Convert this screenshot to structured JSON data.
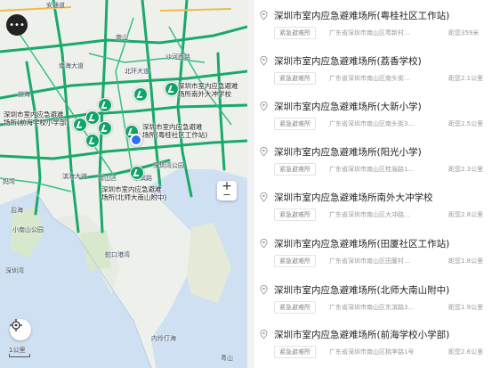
{
  "map": {
    "labels": {
      "a": "安通道",
      "b": "南山",
      "c": "西丽",
      "d": "南海大道",
      "e": "沙河西路",
      "f": "北环大道",
      "g": "滨海大道",
      "h": "南山区",
      "i": "前海",
      "j": "东滨路",
      "k": "妈湾",
      "l": "后海",
      "m": "小南山公园",
      "n": "深圳湾",
      "o": "蛇口港湾",
      "p": "内伶仃海",
      "q": "粤山",
      "r": "深圳湾公园"
    },
    "shelters": {
      "s1": "深圳市室内应急避难\n场所南外大冲学校",
      "s2": "深圳市室内应急避难\n场所(前海学校小学部)",
      "s3": "深圳市室内应急避难\n场所(粤桂社区工作站)",
      "s4": "深圳市室内应急避难\n场所(北师大南山附中)"
    },
    "more_button": "•••",
    "zoom_in": "+",
    "zoom_out": "−",
    "scale": "1公里"
  },
  "list": [
    {
      "title": "深圳市室内应急避难场所(粤桂社区工作站)",
      "tag": "紧急避难所",
      "addr": "广东省深圳市南山区粤新村...",
      "dist": "距您359米"
    },
    {
      "title": "深圳市室内应急避难场所(荔香学校)",
      "tag": "紧急避难所",
      "addr": "广东省深圳市南山区南头街...",
      "dist": "距您2.1公里"
    },
    {
      "title": "深圳市室内应急避难场所(大新小学)",
      "tag": "紧急避难所",
      "addr": "广东省深圳市南山区南头街3...",
      "dist": "距您2.5公里"
    },
    {
      "title": "深圳市室内应急避难场所(阳光小学)",
      "tag": "紧急避难所",
      "addr": "广东省深圳市南山区桂庙路1...",
      "dist": "距您2.3公里"
    },
    {
      "title": "深圳市室内应急避难场所南外大冲学校",
      "tag": "紧急避难所",
      "addr": "广东省深圳市南山区大冲路...",
      "dist": "距您2.8公里"
    },
    {
      "title": "深圳市室内应急避难场所(田厦社区工作站)",
      "tag": "紧急避难所",
      "addr": "广东省深圳市南山区田厦村...",
      "dist": "距您1.8公里"
    },
    {
      "title": "深圳市室内应急避难场所(北师大南山附中)",
      "tag": "紧急避难所",
      "addr": "广东省深圳市南山区东滨路3...",
      "dist": "距您1.9公里"
    },
    {
      "title": "深圳市室内应急避难场所(前海学校小学部)",
      "tag": "紧急避难所",
      "addr": "广东省深圳市南山区桃李路1号",
      "dist": "距您2.6公里"
    }
  ]
}
